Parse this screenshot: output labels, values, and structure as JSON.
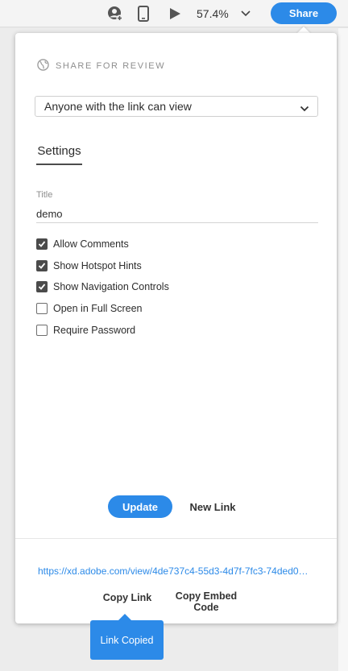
{
  "toolbar": {
    "zoom_value": "57.4%",
    "share_label": "Share",
    "icons": [
      "user-add-icon",
      "mobile-device-icon",
      "play-icon",
      "chevron-down-icon"
    ]
  },
  "panel": {
    "title": "SHARE FOR REVIEW",
    "title_icon": "globe-icon",
    "access_select": {
      "value": "Anyone with the link can view",
      "icon": "chevron-down-icon"
    },
    "tabs": [
      {
        "label": "Settings",
        "selected": true
      }
    ],
    "title_field": {
      "label": "Title",
      "value": "demo"
    },
    "options": [
      {
        "label": "Allow Comments",
        "checked": true
      },
      {
        "label": "Show Hotspot Hints",
        "checked": true
      },
      {
        "label": "Show Navigation Controls",
        "checked": true
      },
      {
        "label": "Open in Full Screen",
        "checked": false
      },
      {
        "label": "Require Password",
        "checked": false
      }
    ],
    "update_label": "Update",
    "new_link_label": "New Link",
    "link_url": "https://xd.adobe.com/view/4de737c4-55d3-4d7f-7fc3-74ded0…",
    "copy_link_label": "Copy Link",
    "copy_embed_label": "Copy Embed Code",
    "tooltip_text": "Link Copied"
  },
  "colors": {
    "accent": "#2c8ae8",
    "checkbox_checked": "#4b4b4b",
    "muted_text": "#8e8e8e"
  }
}
